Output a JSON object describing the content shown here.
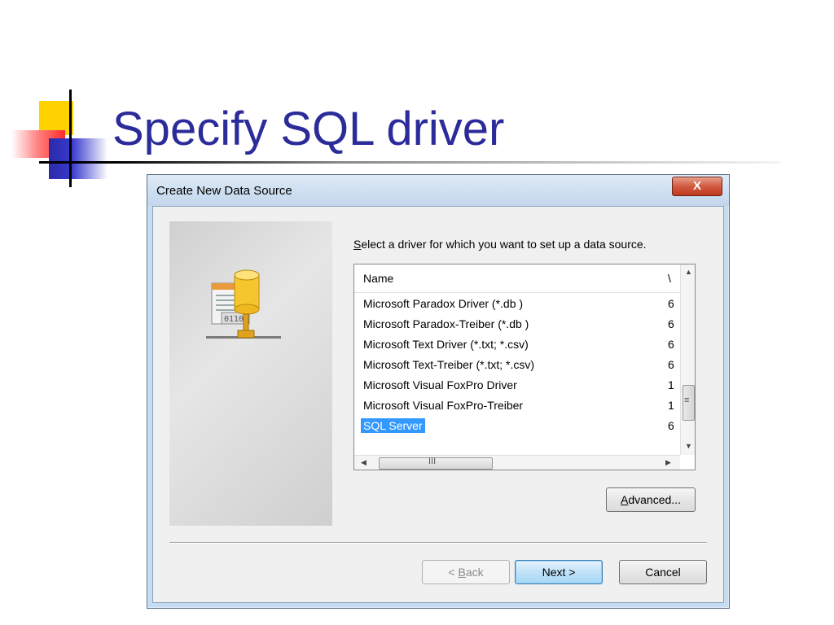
{
  "slide": {
    "title": "Specify SQL driver",
    "colors": {
      "title": "#2b2b9a",
      "accent_yellow": "#ffd200",
      "accent_blue": "#2a2aa8",
      "accent_red": "#ff2a2a"
    }
  },
  "dialog": {
    "title": "Create New Data Source",
    "close_label": "X",
    "prompt": "elect a driver for which you want to set up a data source.",
    "prompt_access_key": "S",
    "list": {
      "columns": [
        "Name",
        "\\"
      ],
      "rows": [
        {
          "name": "Microsoft Paradox Driver (*.db )",
          "version": "6"
        },
        {
          "name": "Microsoft Paradox-Treiber (*.db )",
          "version": "6"
        },
        {
          "name": "Microsoft Text Driver (*.txt; *.csv)",
          "version": "6"
        },
        {
          "name": "Microsoft Text-Treiber (*.txt; *.csv)",
          "version": "6"
        },
        {
          "name": "Microsoft Visual FoxPro Driver",
          "version": "1"
        },
        {
          "name": "Microsoft Visual FoxPro-Treiber",
          "version": "1"
        },
        {
          "name": "SQL Server",
          "version": "6",
          "selected": true
        }
      ],
      "hscroll_thumb_glyph": "III",
      "vscroll_thumb_glyph": "≡"
    },
    "buttons": {
      "advanced": "dvanced...",
      "advanced_key": "A",
      "back_prefix": "< ",
      "back_key": "B",
      "back_rest": "ack",
      "next": "Next >",
      "cancel": "Cancel"
    },
    "icon": "database-driver-icon"
  }
}
